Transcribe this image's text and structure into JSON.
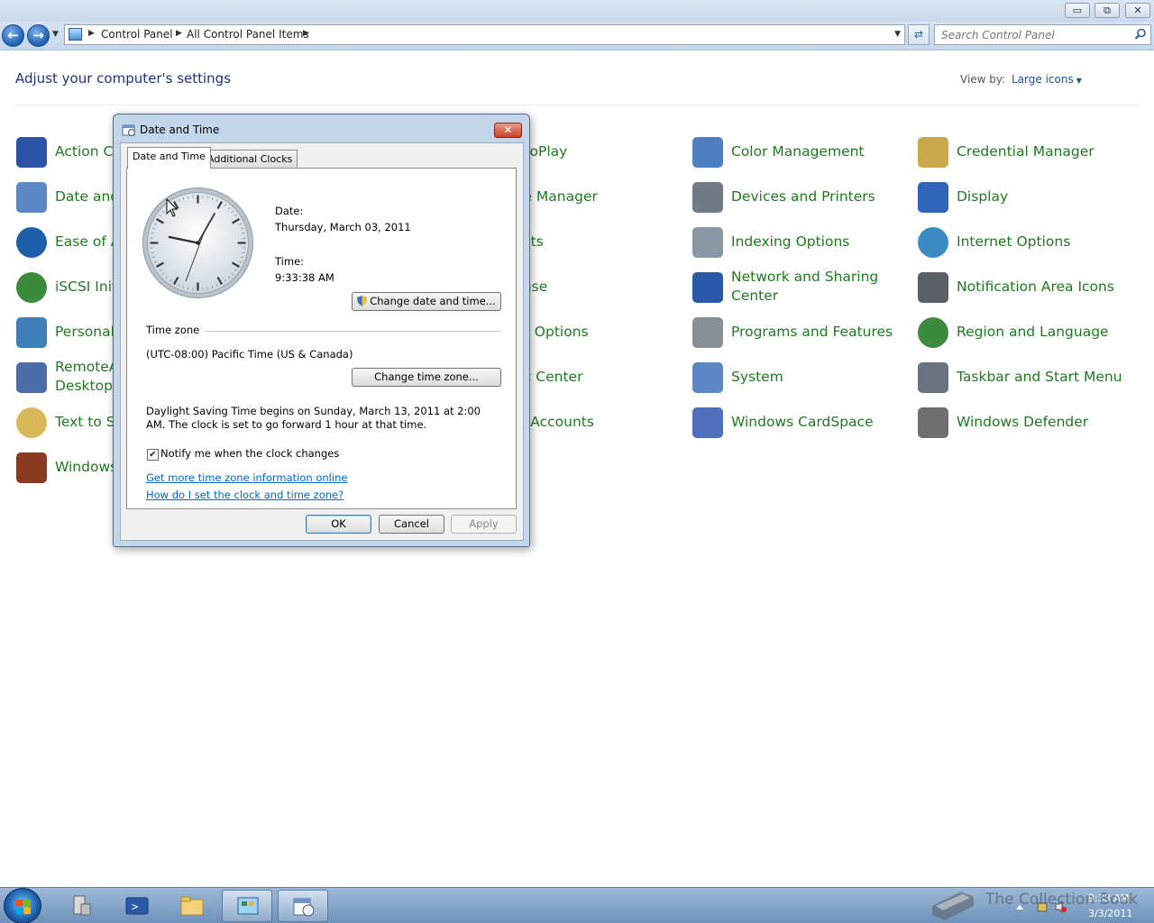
{
  "window": {
    "minimize_glyph": "▭",
    "maximize_glyph": "⧉",
    "close_glyph": "✕"
  },
  "address_bar": {
    "crumbs": [
      "Control Panel",
      "All Control Panel Items"
    ],
    "search_placeholder": "Search Control Panel"
  },
  "content": {
    "title": "Adjust your computer's settings",
    "view_by_label": "View by:",
    "view_by_value": "Large icons"
  },
  "items": [
    {
      "label": "Action Center",
      "icon": "flag-icon",
      "color": "#2a53a8"
    },
    {
      "label": "Date and Time",
      "icon": "calendar-clock-icon",
      "color": "#5b87c4"
    },
    {
      "label": "Ease of Access Center",
      "icon": "ease-of-access-icon",
      "color": "#1d5fa8"
    },
    {
      "label": "iSCSI Initiator",
      "icon": "globe-shield-icon",
      "color": "#3c8a3c"
    },
    {
      "label": "Personalization",
      "icon": "monitor-icon",
      "color": "#3f7fb8"
    },
    {
      "label": "RemoteApp and Desktop Connections",
      "icon": "remote-desktop-icon",
      "color": "#4b6ea8"
    },
    {
      "label": "Text to Speech",
      "icon": "speech-bubble-icon",
      "color": "#d9b85a"
    },
    {
      "label": "Windows Firewall",
      "icon": "firewall-icon",
      "color": "#8a3a1f"
    },
    {
      "label": "AutoPlay",
      "icon": "autoplay-icon",
      "color": "#3a7a3a"
    },
    {
      "label": "Device Manager",
      "icon": "device-manager-icon",
      "color": "#6d6d6d"
    },
    {
      "label": "Fonts",
      "icon": "fonts-icon",
      "color": "#b68b2a"
    },
    {
      "label": "Mouse",
      "icon": "mouse-icon",
      "color": "#777777"
    },
    {
      "label": "Power Options",
      "icon": "power-icon",
      "color": "#3c8a3c"
    },
    {
      "label": "Sync Center",
      "icon": "sync-icon",
      "color": "#3c8a3c"
    },
    {
      "label": "User Accounts",
      "icon": "user-icon",
      "color": "#3f7fb8"
    },
    {
      "label": "Color Management",
      "icon": "color-management-icon",
      "color": "#4d7fc2"
    },
    {
      "label": "Devices and Printers",
      "icon": "printer-icon",
      "color": "#707a86"
    },
    {
      "label": "Indexing Options",
      "icon": "indexing-icon",
      "color": "#8b97a6"
    },
    {
      "label": "Network and Sharing Center",
      "icon": "network-icon",
      "color": "#2a58a8"
    },
    {
      "label": "Programs and Features",
      "icon": "programs-icon",
      "color": "#8a8f96"
    },
    {
      "label": "System",
      "icon": "system-icon",
      "color": "#5b87c4"
    },
    {
      "label": "Windows CardSpace",
      "icon": "cardspace-icon",
      "color": "#4f6fbf"
    },
    {
      "label": "Credential Manager",
      "icon": "vault-icon",
      "color": "#c9a94a"
    },
    {
      "label": "Display",
      "icon": "display-icon",
      "color": "#2f64b8"
    },
    {
      "label": "Internet Options",
      "icon": "internet-options-icon",
      "color": "#3c8ac2"
    },
    {
      "label": "Notification Area Icons",
      "icon": "notification-icon",
      "color": "#5a5f66"
    },
    {
      "label": "Region and Language",
      "icon": "region-icon",
      "color": "#3c8a3c"
    },
    {
      "label": "Taskbar and Start Menu",
      "icon": "taskbar-icon",
      "color": "#6a7380"
    },
    {
      "label": "Windows Defender",
      "icon": "defender-icon",
      "color": "#6f6f6f"
    }
  ],
  "dialog": {
    "title": "Date and Time",
    "tabs": [
      "Date and Time",
      "Additional Clocks"
    ],
    "date_label": "Date:",
    "date_value": "Thursday, March 03, 2011",
    "time_label": "Time:",
    "time_value": "9:33:38 AM",
    "change_datetime_button": "Change date and time...",
    "timezone_group": "Time zone",
    "timezone_value": "(UTC-08:00) Pacific Time (US & Canada)",
    "change_timezone_button": "Change time zone...",
    "dst_text": "Daylight Saving Time begins on Sunday, March 13, 2011 at 2:00 AM. The clock is set to go forward 1 hour at that time.",
    "notify_checked": true,
    "notify_label": "Notify me when the clock changes",
    "link_more_info": "Get more time zone information online",
    "link_how_to": "How do I set the clock and time zone?",
    "ok_button": "OK",
    "cancel_button": "Cancel",
    "apply_button": "Apply"
  },
  "taskbar": {
    "time": "9:33 AM",
    "date": "3/3/2011",
    "watermark": "The Collection Book"
  }
}
